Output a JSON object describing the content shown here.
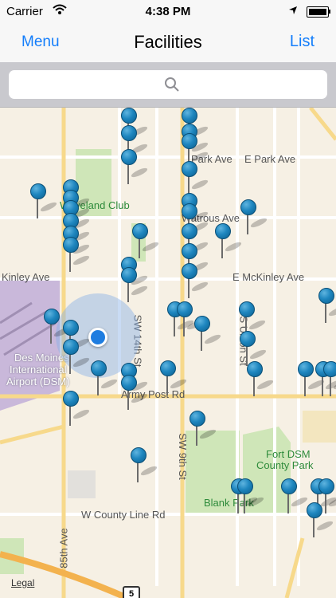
{
  "status_bar": {
    "carrier": "Carrier",
    "time": "4:38 PM"
  },
  "nav": {
    "left_button": "Menu",
    "title": "Facilities",
    "right_button": "List"
  },
  "search": {
    "placeholder": ""
  },
  "map": {
    "labels": {
      "park_ave": "Park Ave",
      "e_park_ave": "E Park Ave",
      "waveland": "Waveland",
      "watrous_ave": "Watrous Ave",
      "kinley_ave": "Kinley Ave",
      "e_mckinley_ave": "E McKinley Ave",
      "sw_14th": "SW 14th St",
      "s_union": "S Union St",
      "airport": "Des Moines International Airport (DSM)",
      "airport_l1": "Des Moines",
      "airport_l2": "International",
      "airport_l3": "Airport (DSM)",
      "army_post": "Army Post Rd",
      "sw_9th": "SW 9th St",
      "fort_dsm_l1": "Fort DSM",
      "fort_dsm_l2": "County Park",
      "blank_park": "Blank Park",
      "w_county_line": "W County Line Rd",
      "85th_ave": "85th Ave",
      "waveland_club": "Waveland Club"
    },
    "legal": "Legal",
    "route_shield": "5",
    "colors": {
      "pin": "#1e86bf",
      "park": "#cfe6b8",
      "airport": "#c9b8da",
      "user": "#1f7de0"
    }
  }
}
